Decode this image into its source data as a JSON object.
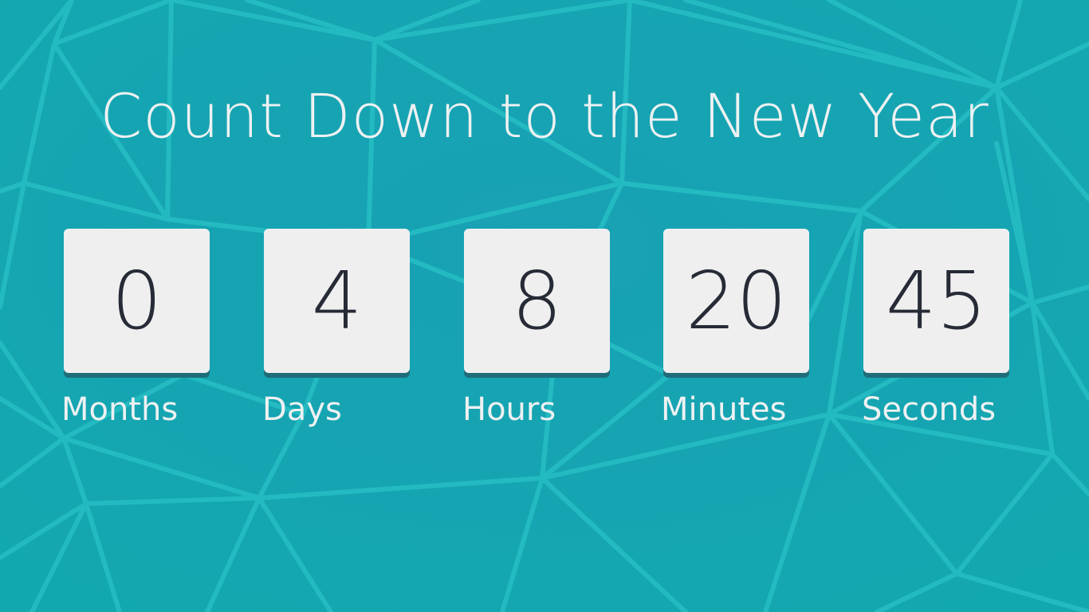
{
  "title": "Count Down to the New Year",
  "countdown": [
    {
      "value": "0",
      "label": "Months"
    },
    {
      "value": "4",
      "label": "Days"
    },
    {
      "value": "8",
      "label": "Hours"
    },
    {
      "value": "20",
      "label": "Minutes"
    },
    {
      "value": "45",
      "label": "Seconds"
    }
  ],
  "colors": {
    "background": "#1aa6b7",
    "pattern_lines": "#22bcc2",
    "card": "#efeff0",
    "digits": "#262b36",
    "text": "#eef1f2"
  }
}
